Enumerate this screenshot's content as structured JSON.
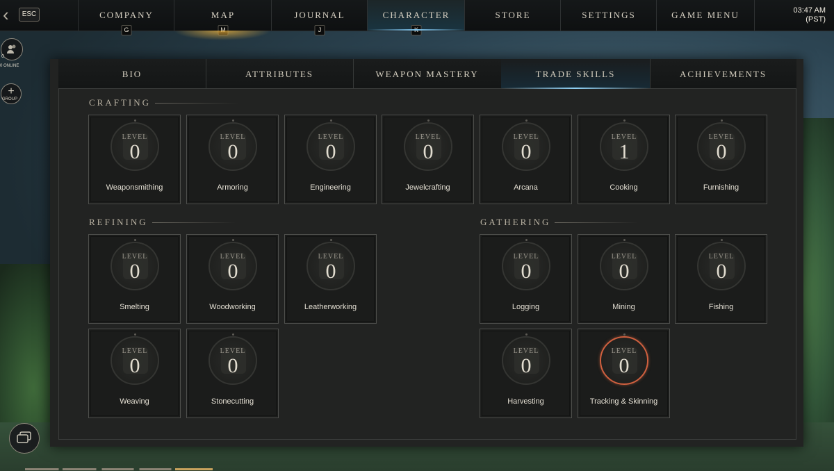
{
  "top_nav": {
    "esc_label": "ESC",
    "tabs": [
      {
        "label": "COMPANY",
        "hotkey": "G"
      },
      {
        "label": "MAP",
        "hotkey": "M"
      },
      {
        "label": "JOURNAL",
        "hotkey": "J"
      },
      {
        "label": "CHARACTER",
        "hotkey": "K"
      },
      {
        "label": "STORE",
        "hotkey": ""
      },
      {
        "label": "SETTINGS",
        "hotkey": ""
      },
      {
        "label": "GAME MENU",
        "hotkey": ""
      }
    ],
    "active_tab": "CHARACTER",
    "clock_time": "03:47 AM",
    "clock_zone": "(PST)"
  },
  "social": {
    "online_count": "0",
    "online_label": "0 ONLINE",
    "group_symbol": "+",
    "group_label": "GROUP"
  },
  "sub_tabs": [
    "BIO",
    "ATTRIBUTES",
    "WEAPON MASTERY",
    "TRADE SKILLS",
    "ACHIEVEMENTS"
  ],
  "active_sub_tab": "TRADE SKILLS",
  "level_word": "LEVEL",
  "sections": {
    "crafting": {
      "title": "CRAFTING",
      "skills": [
        {
          "name": "Weaponsmithing",
          "level": "0"
        },
        {
          "name": "Armoring",
          "level": "0"
        },
        {
          "name": "Engineering",
          "level": "0"
        },
        {
          "name": "Jewelcrafting",
          "level": "0"
        },
        {
          "name": "Arcana",
          "level": "0"
        },
        {
          "name": "Cooking",
          "level": "1"
        },
        {
          "name": "Furnishing",
          "level": "0"
        }
      ]
    },
    "refining": {
      "title": "REFINING",
      "skills": [
        {
          "name": "Smelting",
          "level": "0"
        },
        {
          "name": "Woodworking",
          "level": "0"
        },
        {
          "name": "Leatherworking",
          "level": "0"
        },
        {
          "name": "Weaving",
          "level": "0"
        },
        {
          "name": "Stonecutting",
          "level": "0"
        }
      ]
    },
    "gathering": {
      "title": "GATHERING",
      "skills": [
        {
          "name": "Logging",
          "level": "0"
        },
        {
          "name": "Mining",
          "level": "0"
        },
        {
          "name": "Fishing",
          "level": "0"
        },
        {
          "name": "Harvesting",
          "level": "0"
        },
        {
          "name": "Tracking & Skinning",
          "level": "0",
          "progress_color": "#d0603f"
        }
      ]
    }
  },
  "colors": {
    "accent_blue": "#7fc6f0",
    "map_glow": "#f0b43c",
    "progress_ring": "#d0603f"
  }
}
